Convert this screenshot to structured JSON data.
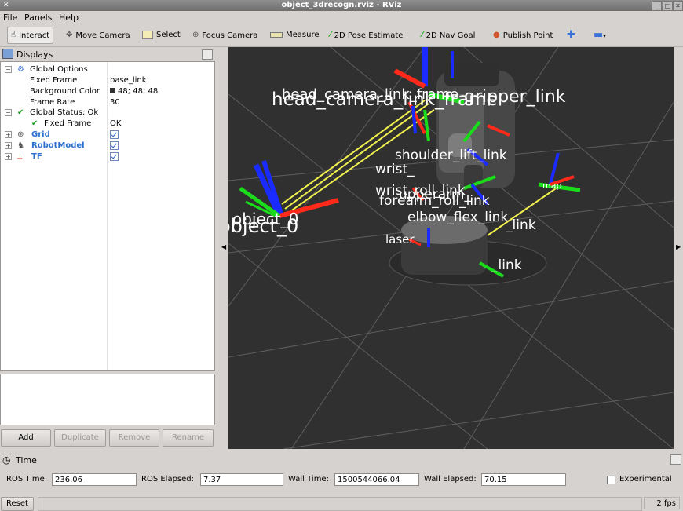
{
  "window": {
    "title": "object_3drecogn.rviz - RViz"
  },
  "menu": [
    "File",
    "Panels",
    "Help"
  ],
  "toolbar": {
    "interact": "Interact",
    "move_camera": "Move Camera",
    "select": "Select",
    "focus_camera": "Focus Camera",
    "measure": "Measure",
    "pose_estimate": "2D Pose Estimate",
    "nav_goal": "2D Nav Goal",
    "publish_point": "Publish Point"
  },
  "displays": {
    "title": "Displays",
    "global_options": "Global Options",
    "fixed_frame_label": "Fixed Frame",
    "fixed_frame_value": "base_link",
    "background_color_label": "Background Color",
    "background_color_value": "48; 48; 48",
    "background_color_hex": "#303030",
    "frame_rate_label": "Frame Rate",
    "frame_rate_value": "30",
    "global_status": "Global Status: Ok",
    "status_fixed_frame_label": "Fixed Frame",
    "status_fixed_frame_value": "OK",
    "grid": "Grid",
    "robot_model": "RobotModel",
    "tf": "TF"
  },
  "buttons": {
    "add": "Add",
    "duplicate": "Duplicate",
    "remove": "Remove",
    "rename": "Rename"
  },
  "viewport_labels": {
    "head": "head_camera_link_frame",
    "object": "object_0",
    "gripper": "gripper_link",
    "shoulder": "shoulder_lift_link",
    "wrist": "wrist_",
    "wrist_roll": "wrist_roll_link",
    "forearm": "forearm_roll_link",
    "upperarm": "upperarm_",
    "elbow": "elbow_flex_link",
    "torso": "_link",
    "laser": "laser",
    "map": "map",
    "base": "_link"
  },
  "time": {
    "title": "Time",
    "ros_time_label": "ROS Time:",
    "ros_time": "236.06",
    "ros_elapsed_label": "ROS Elapsed:",
    "ros_elapsed": "7.37",
    "wall_time_label": "Wall Time:",
    "wall_time": "1500544066.04",
    "wall_elapsed_label": "Wall Elapsed:",
    "wall_elapsed": "70.15",
    "experimental": "Experimental"
  },
  "status": {
    "reset": "Reset",
    "fps": "2 fps"
  }
}
